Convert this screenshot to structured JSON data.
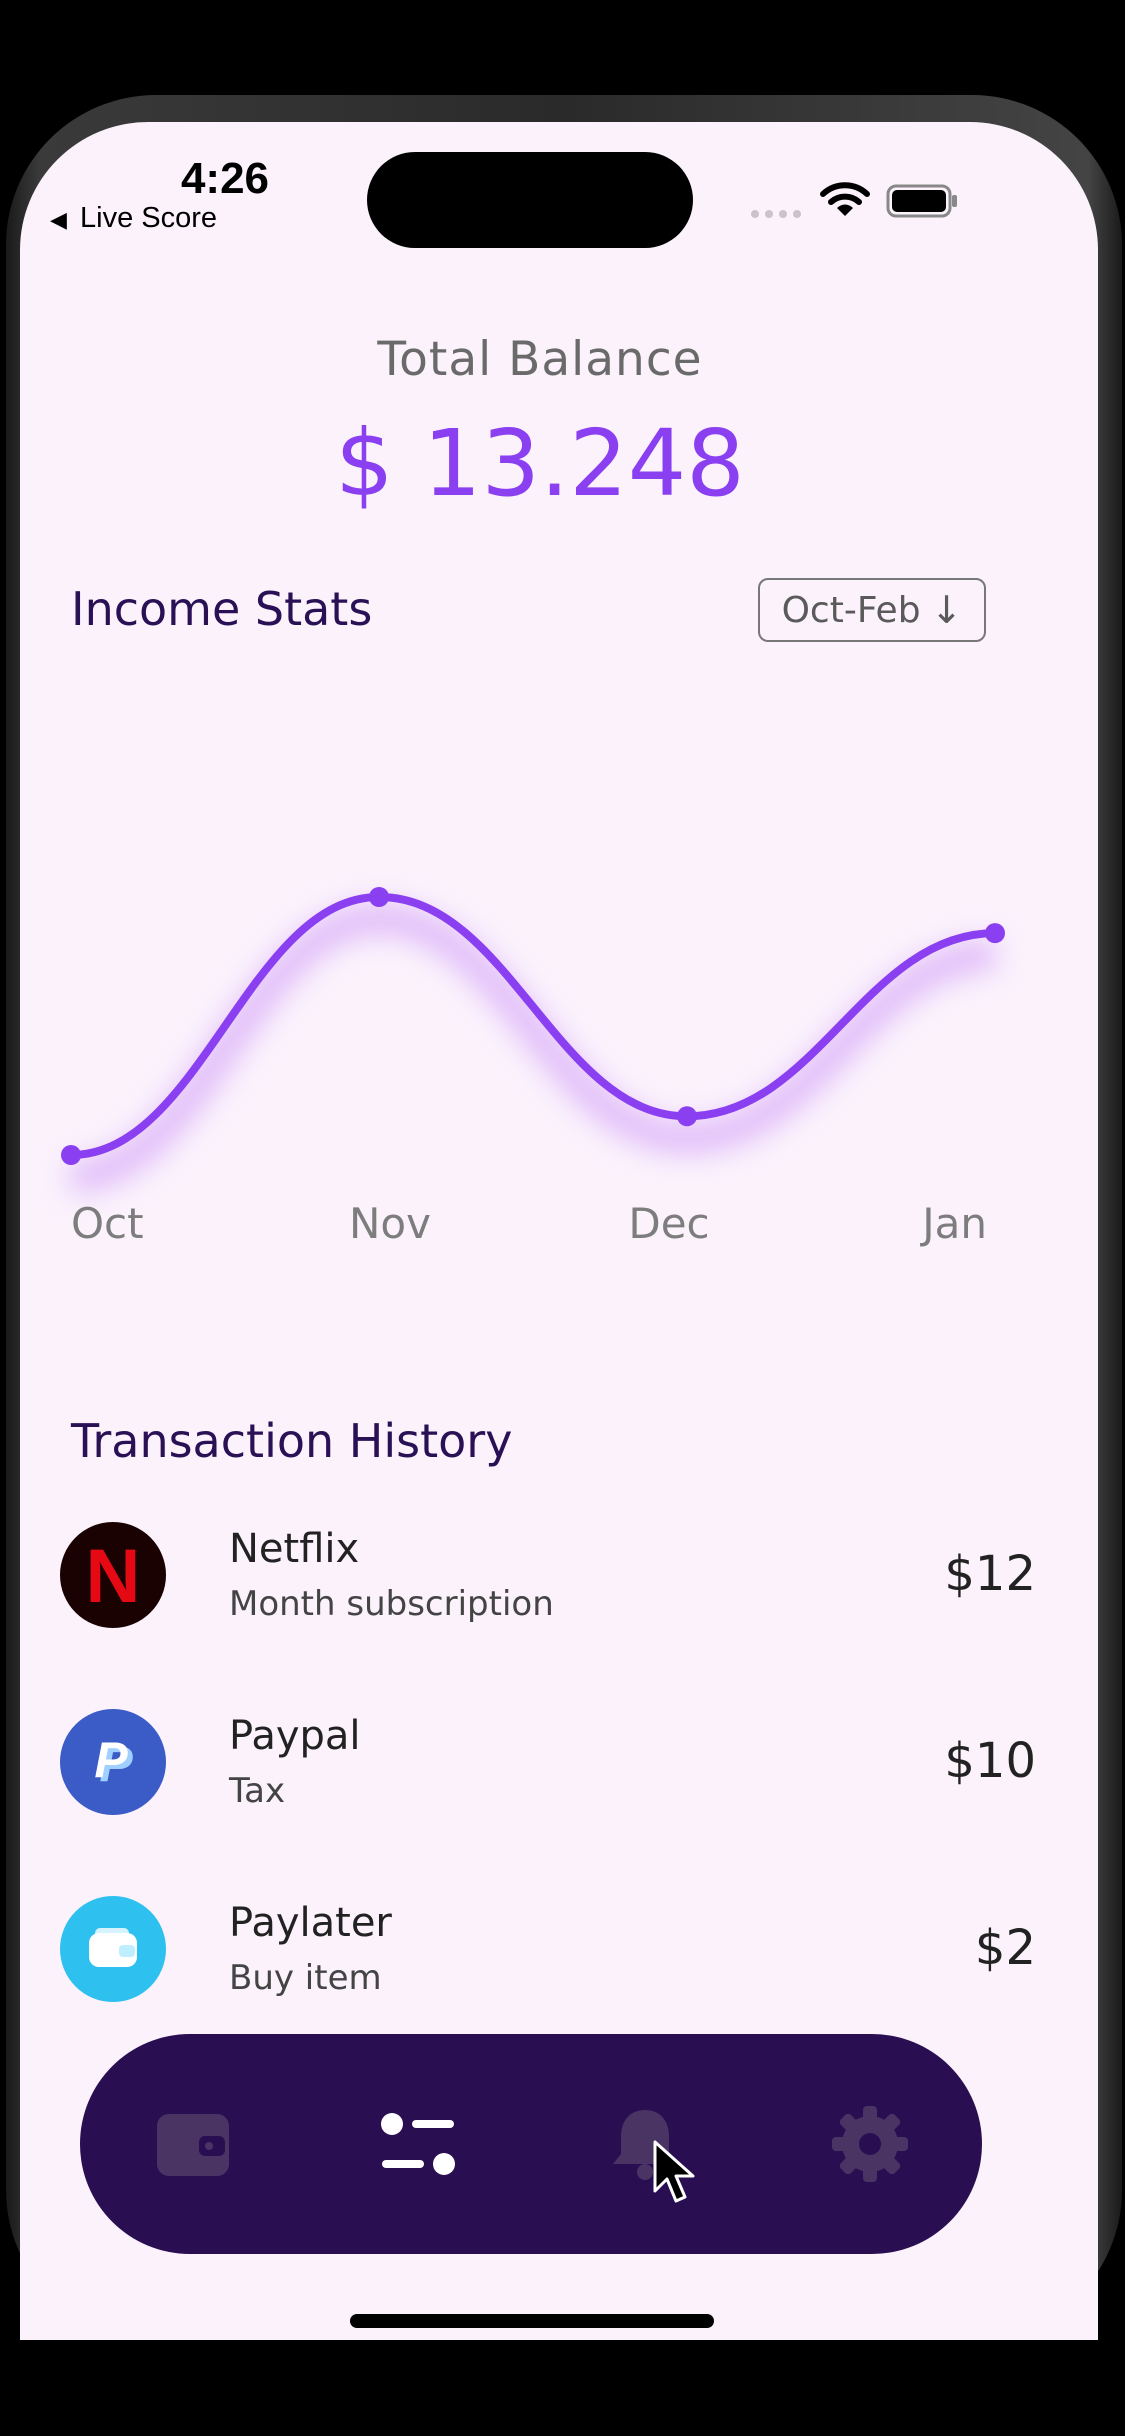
{
  "status_bar": {
    "time": "4:26",
    "back_label": "Live Score"
  },
  "balance": {
    "label": "Total Balance",
    "value": "$ 13.248"
  },
  "income_stats": {
    "title": "Income Stats",
    "period_button": "Oct-Feb"
  },
  "chart_data": {
    "type": "line",
    "categories": [
      "Oct",
      "Nov",
      "Dec",
      "Jan"
    ],
    "series": [
      {
        "values": [
          0.0,
          1.0,
          0.15,
          0.86
        ]
      }
    ],
    "ylim": [
      0,
      1
    ],
    "grid": false,
    "color": "#8a3ff1"
  },
  "transactions": {
    "title": "Transaction History",
    "items": [
      {
        "name": "Netflix",
        "desc": "Month subscription",
        "amount": "$12",
        "icon": "netflix-logo",
        "logo_text": "N",
        "color": "#1a0202"
      },
      {
        "name": "Paypal",
        "desc": "Tax",
        "amount": "$10",
        "icon": "paypal-logo",
        "logo_text": "P",
        "color": "#3b5cc6"
      },
      {
        "name": "Paylater",
        "desc": "Buy item",
        "amount": "$2",
        "icon": "wallet-logo",
        "logo_text": "",
        "color": "#2ec1f0"
      }
    ]
  },
  "bottom_nav": {
    "items": [
      {
        "icon": "wallet-icon",
        "active": false
      },
      {
        "icon": "sliders-icon",
        "active": true
      },
      {
        "icon": "bell-icon",
        "active": false
      },
      {
        "icon": "gear-icon",
        "active": false
      }
    ],
    "bg_color": "#2a0e52"
  }
}
